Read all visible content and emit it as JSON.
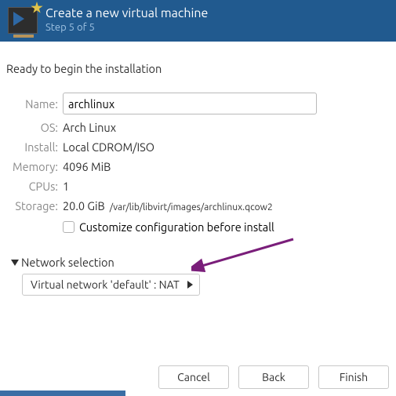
{
  "header": {
    "title": "Create a new virtual machine",
    "subtitle": "Step 5 of 5"
  },
  "intro": "Ready to begin the installation",
  "labels": {
    "name": "Name:",
    "os": "OS:",
    "install": "Install:",
    "memory": "Memory:",
    "cpus": "CPUs:",
    "storage": "Storage:"
  },
  "values": {
    "name": "archlinux",
    "os": "Arch Linux",
    "install": "Local CDROM/ISO",
    "memory": "4096 MiB",
    "cpus": "1",
    "storage_size": "20.0 GiB",
    "storage_path": "/var/lib/libvirt/images/archlinux.qcow2"
  },
  "customize_label": "Customize configuration before install",
  "network": {
    "section_label": "Network selection",
    "selected": "Virtual network 'default' : NAT"
  },
  "buttons": {
    "cancel": "Cancel",
    "back": "Back",
    "finish": "Finish"
  },
  "colors": {
    "header_bg": "#215a8f",
    "arrow": "#7a1e7a"
  }
}
